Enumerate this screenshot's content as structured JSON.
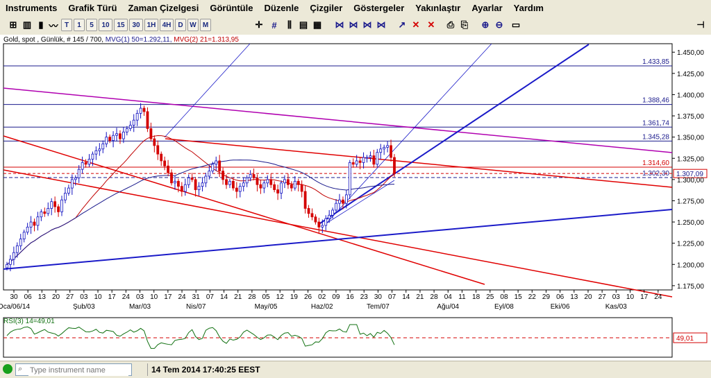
{
  "menu": [
    "Instruments",
    "Grafik Türü",
    "Zaman Çizelgesi",
    "Görüntüle",
    "Düzenle",
    "Çizgiler",
    "Göstergeler",
    "Yakınlaştır",
    "Ayarlar",
    "Yardım"
  ],
  "timeframes": [
    "T",
    "1",
    "5",
    "10",
    "15",
    "30",
    "1H",
    "4H",
    "D",
    "W",
    "M"
  ],
  "chart_info": "Gold, spot , Günlük, # 145 / 700, ",
  "mvg1_label": "MVG(1) 50=1.292,11, ",
  "mvg2_label": "MVG(2) 21=1.313,95",
  "rsi_label": "RSI(3) 14=49,01",
  "rsi_value": "49,01",
  "current_price": "1.307,09",
  "colors": {
    "up": "#1010c0",
    "down": "#d40000",
    "mvg1": "#1a1a8c",
    "mvg2": "#c00000",
    "trend_red": "#e00000",
    "trend_blue": "#1a1ac8",
    "magenta": "#b000b0",
    "rsi": "#107010"
  },
  "search": {
    "placeholder": "Type instrument name"
  },
  "status": "14 Tem 2014 17:40:25 EEST",
  "chart_data": {
    "type": "candlestick",
    "y_ticks": [
      "1.450,00",
      "1.425,00",
      "1.400,00",
      "1.375,00",
      "1.350,00",
      "1.325,00",
      "1.300,00",
      "1.275,00",
      "1.250,00",
      "1.225,00",
      "1.200,00",
      "1.175,00"
    ],
    "ylim": [
      1170,
      1460
    ],
    "x_day_labels": [
      "30",
      "06",
      "13",
      "20",
      "27",
      "03",
      "10",
      "17",
      "24",
      "03",
      "10",
      "17",
      "24",
      "31",
      "07",
      "14",
      "21",
      "28",
      "05",
      "12",
      "19",
      "26",
      "02",
      "09",
      "16",
      "23",
      "30",
      "07",
      "14",
      "21",
      "28",
      "04",
      "11",
      "18",
      "25",
      "08",
      "15",
      "22",
      "29",
      "06",
      "13",
      "20",
      "27",
      "03",
      "10",
      "17",
      "24"
    ],
    "x_month_labels": [
      "Oca/06/14",
      "Şub/03",
      "Mar/03",
      "Nis/07",
      "May/05",
      "Haz/02",
      "Tem/07",
      "Ağu/04",
      "Eyl/08",
      "Eki/06",
      "Kas/03"
    ],
    "horizontal_levels": [
      {
        "label": "1.433,85",
        "value": 1433.85
      },
      {
        "label": "1.388,46",
        "value": 1388.46
      },
      {
        "label": "1.361,74",
        "value": 1361.74
      },
      {
        "label": "1.345,28",
        "value": 1345.28
      },
      {
        "label": "1.314,60",
        "value": 1314.6
      },
      {
        "label": "1.302,30",
        "value": 1302.3
      }
    ],
    "close_series": [
      1200,
      1206,
      1214,
      1222,
      1230,
      1238,
      1244,
      1250,
      1246,
      1256,
      1262,
      1260,
      1266,
      1274,
      1268,
      1262,
      1276,
      1284,
      1290,
      1300,
      1302,
      1312,
      1320,
      1318,
      1324,
      1330,
      1334,
      1336,
      1342,
      1350,
      1346,
      1352,
      1354,
      1348,
      1356,
      1360,
      1364,
      1370,
      1378,
      1384,
      1380,
      1360,
      1348,
      1340,
      1330,
      1322,
      1316,
      1308,
      1296,
      1298,
      1292,
      1286,
      1294,
      1302,
      1300,
      1288,
      1292,
      1296,
      1304,
      1310,
      1318,
      1322,
      1310,
      1300,
      1294,
      1298,
      1290,
      1286,
      1292,
      1296,
      1302,
      1306,
      1302,
      1294,
      1290,
      1296,
      1300,
      1294,
      1288,
      1284,
      1296,
      1300,
      1294,
      1290,
      1298,
      1294,
      1286,
      1266,
      1260,
      1256,
      1250,
      1244,
      1246,
      1254,
      1258,
      1264,
      1272,
      1276,
      1272,
      1282,
      1320,
      1318,
      1322,
      1320,
      1326,
      1326,
      1328,
      1318,
      1332,
      1336,
      1338,
      1340,
      1326,
      1307
    ],
    "rsi_dashed_level": 49.01
  }
}
